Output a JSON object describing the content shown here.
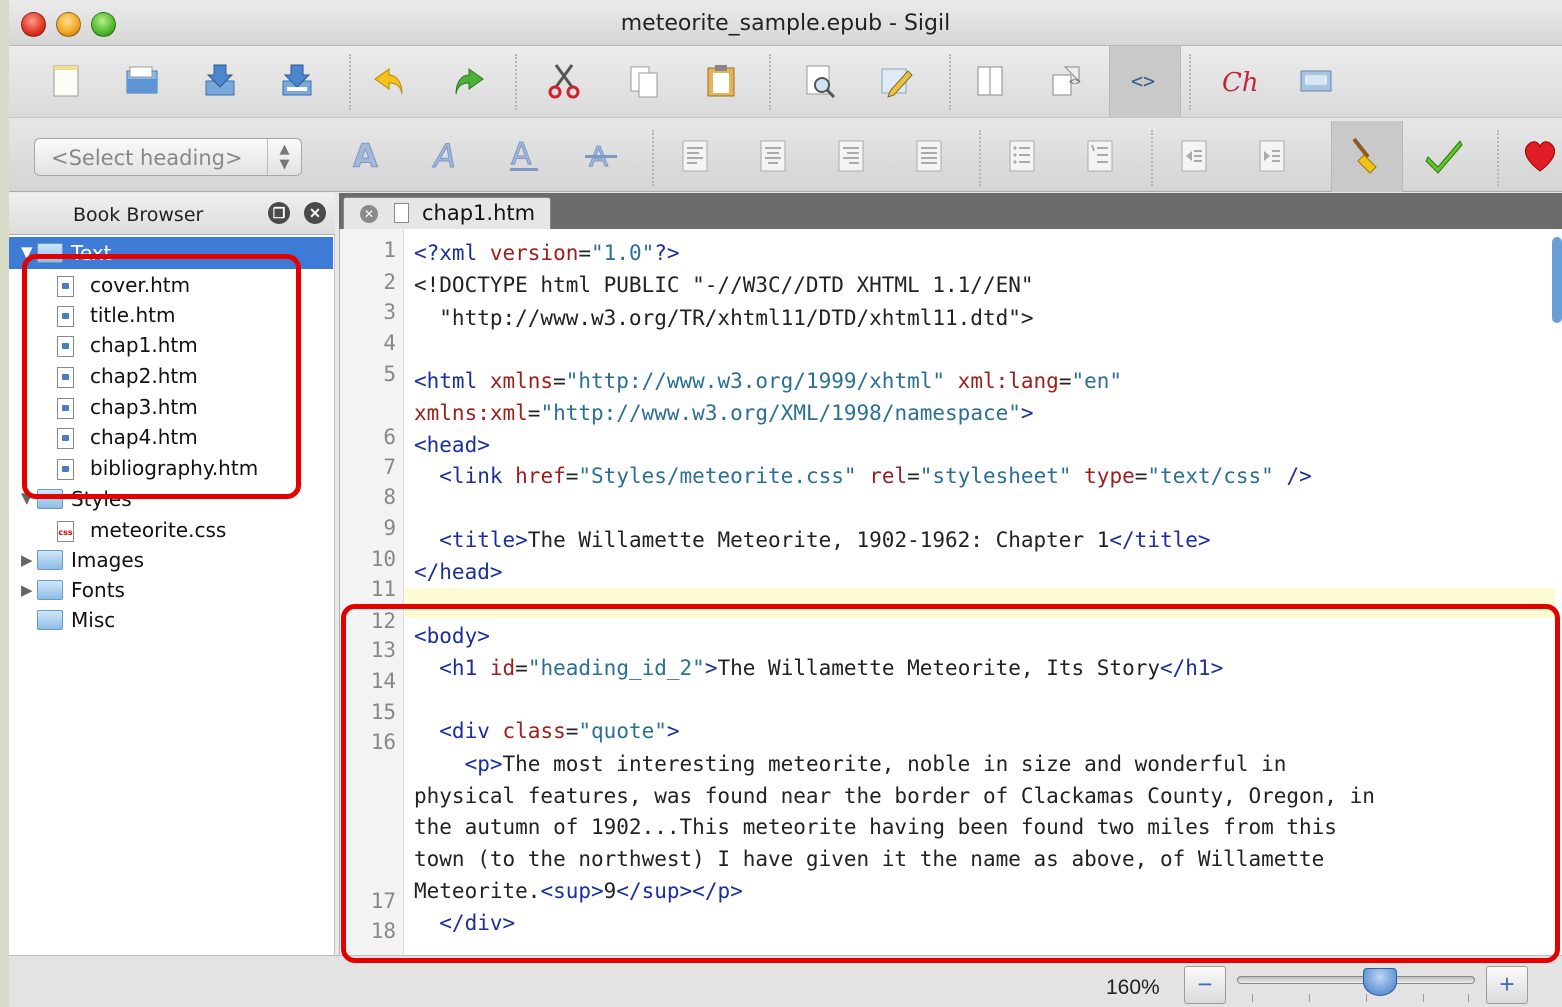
{
  "window": {
    "title": "meteorite_sample.epub - Sigil"
  },
  "toolbar": {
    "heading_select": "<Select heading>",
    "buttons_row1": [
      "new-file-icon",
      "open-icon",
      "save-icon",
      "save-as-icon",
      "undo-icon",
      "redo-icon",
      "cut-icon",
      "copy-icon",
      "paste-icon",
      "find-replace-icon",
      "meta-editor-icon",
      "book-view-icon",
      "split-view-icon",
      "code-view-icon",
      "spellcheck-icon",
      "tiles-icon"
    ],
    "buttons_row2": [
      "bold-icon",
      "italic-icon",
      "underline-icon",
      "strikethrough-icon",
      "align-left-icon",
      "align-center-icon",
      "align-right-icon",
      "align-justify-icon",
      "bullet-list-icon",
      "numbered-list-icon",
      "decrease-indent-icon",
      "increase-indent-icon",
      "clean-source-icon",
      "validate-icon",
      "donate-icon"
    ]
  },
  "book_browser": {
    "title": "Book Browser",
    "text_folder": "Text",
    "text_files": [
      "cover.htm",
      "title.htm",
      "chap1.htm",
      "chap2.htm",
      "chap3.htm",
      "chap4.htm",
      "bibliography.htm"
    ],
    "styles_folder": "Styles",
    "styles_files": [
      "meteorite.css"
    ],
    "other_folders": [
      "Images",
      "Fonts",
      "Misc"
    ]
  },
  "editor": {
    "tab_label": "chap1.htm",
    "line_numbers": [
      "1",
      "2",
      "3",
      "4",
      "5",
      "6",
      "7",
      "8",
      "9",
      "10",
      "11",
      "12",
      "13",
      "14",
      "15",
      "16",
      "17",
      "18"
    ],
    "code": {
      "l1": {
        "a": "<?xml ",
        "b": "version",
        "c": "=",
        "d": "\"1.0\"",
        "e": "?>"
      },
      "l2": "<!DOCTYPE html PUBLIC \"-//W3C//DTD XHTML 1.1//EN\"",
      "l3": "  \"http://www.w3.org/TR/xhtml11/DTD/xhtml11.dtd\">",
      "l5": {
        "a": "<html ",
        "b": "xmlns",
        "c": "=",
        "d": "\"http://www.w3.org/1999/xhtml\" ",
        "e": "xml:lang",
        "f": "=",
        "g": "\"en\""
      },
      "l5b": {
        "a": "xmlns:xml",
        "b": "=",
        "c": "\"http://www.w3.org/XML/1998/namespace\"",
        "d": ">"
      },
      "l6": "<head>",
      "l7": {
        "a": "  <link ",
        "b": "href",
        "c": "=",
        "d": "\"Styles/meteorite.css\" ",
        "e": "rel",
        "f": "=",
        "g": "\"stylesheet\" ",
        "h": "type",
        "i": "=",
        "j": "\"text/css\"",
        "k": " />"
      },
      "l9": {
        "a": "  <title>",
        "b": "The Willamette Meteorite, 1902-1962: Chapter 1",
        "c": "</title>"
      },
      "l10": "</head>",
      "l13": "<body>",
      "l14": {
        "a": "  <h1 ",
        "b": "id",
        "c": "=",
        "d": "\"heading_id_2\"",
        "e": ">",
        "f": "The Willamette Meteorite, Its Story",
        "g": "</h1>"
      },
      "l16": {
        "a": "  <div ",
        "b": "class",
        "c": "=",
        "d": "\"quote\"",
        "e": ">"
      },
      "l16b": {
        "a": "    <p>",
        "b": "The most interesting meteorite, noble in size and wonderful in"
      },
      "l16c": "physical features, was found near the border of Clackamas County, Oregon, in",
      "l16d": "the autumn of 1902...This meteorite having been found two miles from this",
      "l16e": "town (to the northwest) I have given it the name as above, of Willamette",
      "l17": {
        "a": "Meteorite.",
        "b": "<sup>",
        "c": "9",
        "d": "</sup></p>"
      },
      "l18": "  </div>"
    }
  },
  "status": {
    "zoom": "160%",
    "zoom_out": "−",
    "zoom_in": "+",
    "zoom_level": 0.6
  },
  "annotation_color": "#e50000"
}
